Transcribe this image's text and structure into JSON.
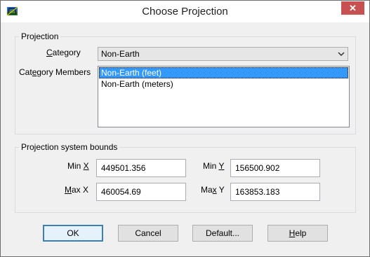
{
  "window": {
    "title": "Choose Projection",
    "close_glyph": "✕"
  },
  "projection": {
    "group_label": "Projection",
    "category_label_pre": "",
    "category_label_u": "C",
    "category_label_post": "ategory",
    "category_value": "Non-Earth",
    "members_label_pre": "Cat",
    "members_label_u": "e",
    "members_label_post": "gory Members",
    "members": [
      "Non-Earth (feet)",
      "Non-Earth (meters)"
    ],
    "selected_index": 0
  },
  "bounds": {
    "group_label": "Projection system bounds",
    "min_x_label_pre": "Min ",
    "min_x_label_u": "X",
    "min_x_value": "449501.356",
    "min_y_label_pre": "Min ",
    "min_y_label_u": "Y",
    "min_y_value": "156500.902",
    "max_x_label_u": "M",
    "max_x_label_post": "ax X",
    "max_x_value": "460054.69",
    "max_y_label_pre": "Ma",
    "max_y_label_u": "x",
    "max_y_label_post": " Y",
    "max_y_value": "163853.183"
  },
  "buttons": {
    "ok": "OK",
    "cancel": "Cancel",
    "default": "Default...",
    "help_u": "H",
    "help_post": "elp"
  },
  "icons": {
    "app": "globe-app-icon",
    "close": "close-icon",
    "dropdown": "chevron-down-icon"
  }
}
